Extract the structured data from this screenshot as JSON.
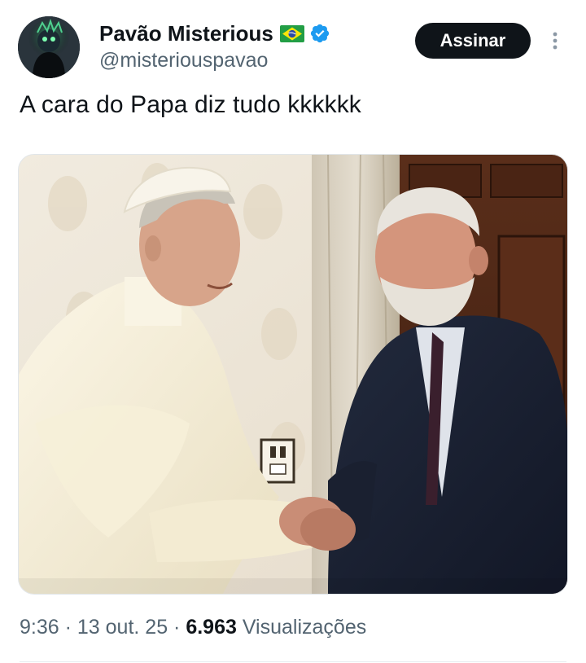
{
  "author": {
    "display_name": "Pavão Misterious",
    "handle": "@misteriouspavao",
    "badges": [
      "brazil-flag-icon",
      "verified-icon"
    ]
  },
  "actions": {
    "subscribe_label": "Assinar",
    "more_icon": "more-vertical-icon"
  },
  "tweet": {
    "text": "A cara do Papa diz tudo kkkkkk"
  },
  "meta": {
    "time": "9:36",
    "sep1": " · ",
    "date": "13 out. 25",
    "sep2": " · ",
    "views_count": "6.963",
    "views_label": " Visualizações"
  },
  "colors": {
    "text_primary": "#0f1419",
    "text_secondary": "#536471",
    "verified_blue": "#1d9bf0",
    "button_bg": "#0f1419"
  }
}
